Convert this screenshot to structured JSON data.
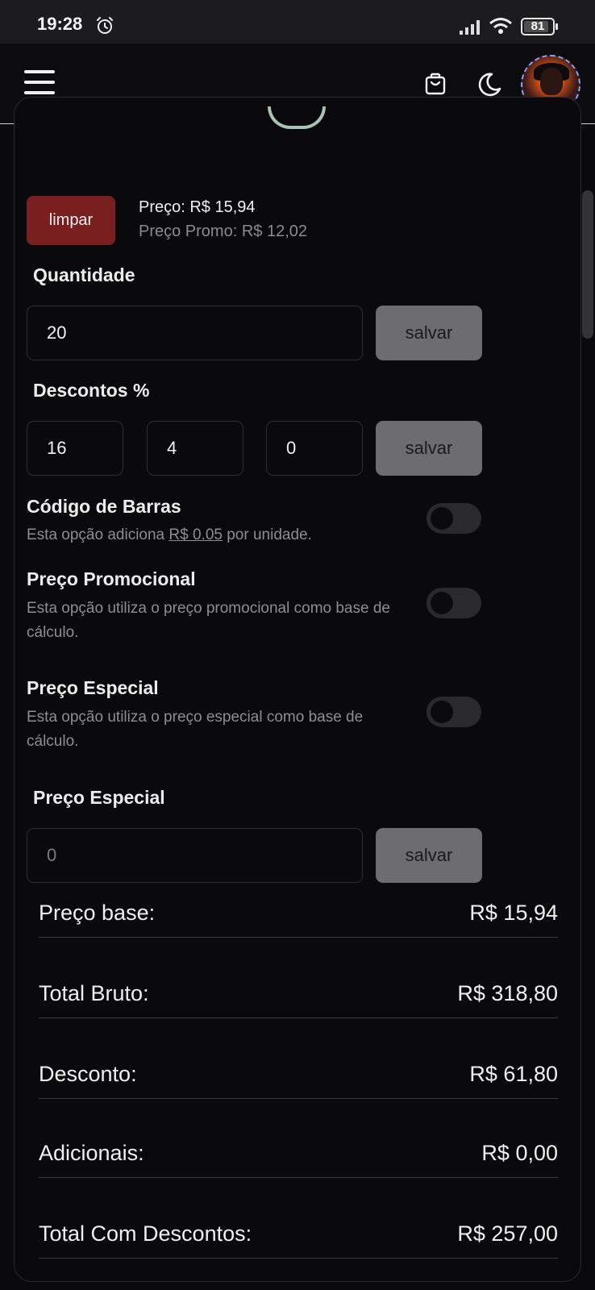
{
  "status_bar": {
    "time": "19:28",
    "battery": "81",
    "icons": [
      "alarm-icon",
      "signal-icon",
      "wifi-icon",
      "battery-icon"
    ]
  },
  "navbar": {
    "icons": [
      "menu-icon",
      "cart-icon",
      "moon-icon"
    ],
    "avatar": "user-avatar"
  },
  "product": {
    "clear_label": "limpar",
    "price": "Preço: R$ 15,94",
    "promo_price": "Preço Promo: R$ 12,02"
  },
  "quantity": {
    "label": "Quantidade",
    "value": "20",
    "save_label": "salvar"
  },
  "discounts": {
    "label": "Descontos %",
    "values": [
      "16",
      "4",
      "0"
    ],
    "save_label": "salvar"
  },
  "options": [
    {
      "title": "Código de Barras",
      "desc_before": "Esta opção adiciona ",
      "desc_link": "R$ 0.05",
      "desc_after": " por unidade.",
      "enabled": false
    },
    {
      "title": "Preço Promocional",
      "desc": "Esta opção utiliza o preço promocional como base de cálculo.",
      "enabled": false
    },
    {
      "title": "Preço Especial",
      "desc": "Esta opção utiliza o preço especial como base de cálculo.",
      "enabled": false
    }
  ],
  "special_price": {
    "label": "Preço Especial",
    "placeholder": "0",
    "save_label": "salvar"
  },
  "summary": [
    {
      "label": "Preço base:",
      "value": "R$ 15,94"
    },
    {
      "label": "Total Bruto:",
      "value": "R$ 318,80"
    },
    {
      "label": "Desconto:",
      "value": "R$ 61,80"
    },
    {
      "label": "Adicionais:",
      "value": "R$ 0,00"
    },
    {
      "label": "Total Com Descontos:",
      "value": "R$ 257,00"
    }
  ]
}
